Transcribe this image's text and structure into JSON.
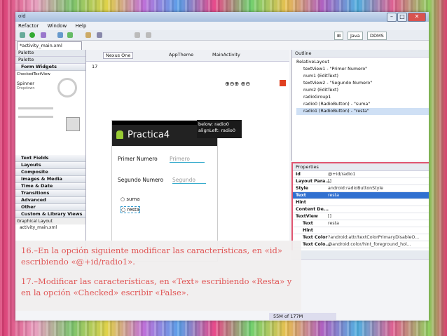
{
  "window": {
    "title": "oid",
    "subtitle": ""
  },
  "menu": [
    "Refactor",
    "Window",
    "Help"
  ],
  "perspectives": {
    "java": "Java",
    "ddms": "DDMS"
  },
  "editor": {
    "tab": "*activity_main.xml",
    "device": "Nexus One",
    "theme": "AppTheme",
    "activity": "MainActivity",
    "api": "17",
    "app_title": "Practica4",
    "label1": "Primer Numero",
    "hint1": "Primero",
    "label2": "Segundo Numero",
    "hint2": "Segundo",
    "radio1": "suma",
    "radio2": "resta",
    "tooltip_line1": "below: radio0",
    "tooltip_line2": "alignLeft: radio0",
    "bottom_tabs": [
      "Graphical Layout",
      "activity_main.xml"
    ]
  },
  "palette": {
    "title": "Palette",
    "sub": "Palette",
    "group": "Form Widgets",
    "widget1": "CheckedTextView",
    "widget2": "Spinner",
    "widget2_sub": "Dropdown",
    "categories": [
      "Text Fields",
      "Layouts",
      "Composite",
      "Images & Media",
      "Time & Date",
      "Transitions",
      "Advanced",
      "Other",
      "Custom & Library Views"
    ]
  },
  "outline": {
    "title": "Outline",
    "items": [
      "RelativeLayout",
      "textView1 - \"Primer Numero\"",
      "num1 (EditText)",
      "textView2 - \"Segundo Numero\"",
      "num2 (EditText)",
      "radioGroup1",
      "radio0 (RadioButton) - \"suma\"",
      "radio1 (RadioButton) - \"resta\""
    ]
  },
  "properties": {
    "title": "Properties",
    "rows": [
      {
        "k": "Id",
        "v": "@+id/radio1"
      },
      {
        "k": "Layout Para...",
        "v": "[]"
      },
      {
        "k": "Style",
        "v": "android:radioButtonStyle"
      },
      {
        "k": "Text",
        "v": "resta"
      },
      {
        "k": "Hint",
        "v": ""
      },
      {
        "k": "Content De...",
        "v": ""
      },
      {
        "k": "TextView",
        "v": "[]"
      },
      {
        "k": "Text",
        "v": "resta"
      },
      {
        "k": "Hint",
        "v": ""
      },
      {
        "k": "Text Color",
        "v": "?android:attr/textColorPrimaryDisableO..."
      },
      {
        "k": "Text Colo...",
        "v": "@android:color/hint_foreground_hol..."
      }
    ]
  },
  "overlay": {
    "p1": "16.–En la opción siguiente modificar las características, en «id» escribiendo «@+id/radio1».",
    "p2": "17.–Modificar las características, en «Text» escribiendo «Resta» y en la opción «Checked» escribir «False»."
  },
  "memory": "55M of 177M"
}
